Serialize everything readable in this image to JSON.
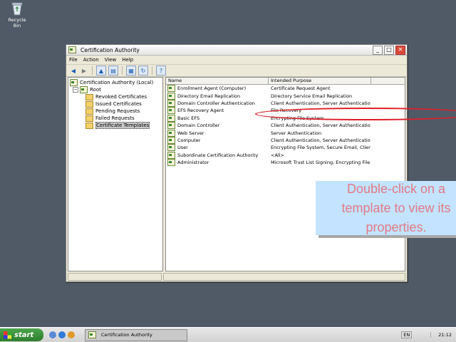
{
  "desktop": {
    "recycle_bin_label": "Recycle Bin"
  },
  "window": {
    "title": "Certification Authority",
    "buttons": {
      "minimize": "_",
      "maximize": "□",
      "close": "✕"
    }
  },
  "menu": [
    "File",
    "Action",
    "View",
    "Help"
  ],
  "tree": {
    "root_label": "Certification Authority (Local)",
    "ca_label": "Root",
    "folders": [
      "Revoked Certificates",
      "Issued Certificates",
      "Pending Requests",
      "Failed Requests",
      "Certificate Templates"
    ],
    "selected_index": 4
  },
  "list": {
    "headers": [
      "Name",
      "Intended Purpose"
    ],
    "rows": [
      {
        "name": "Enrollment Agent (Computer)",
        "purpose": "Certificate Request Agent"
      },
      {
        "name": "Directory Email Replication",
        "purpose": "Directory Service Email Replication"
      },
      {
        "name": "Domain Controller Authentication",
        "purpose": "Client Authentication, Server Authenticatio..."
      },
      {
        "name": "EFS Recovery Agent",
        "purpose": "File Recovery"
      },
      {
        "name": "Basic EFS",
        "purpose": "Encrypting File System"
      },
      {
        "name": "Domain Controller",
        "purpose": "Client Authentication, Server Authentication"
      },
      {
        "name": "Web Server",
        "purpose": "Server Authentication"
      },
      {
        "name": "Computer",
        "purpose": "Client Authentication, Server Authentication"
      },
      {
        "name": "User",
        "purpose": "Encrypting File System, Secure Email, Clien..."
      },
      {
        "name": "Subordinate Certification Authority",
        "purpose": "<All>"
      },
      {
        "name": "Administrator",
        "purpose": "Microsoft Trust List Signing, Encrypting File..."
      }
    ]
  },
  "callout": {
    "text": "Double-click on a\ntemplate to view its\nproperties."
  },
  "colors": {
    "highlight_ellipse": "#e0202a",
    "callout_bg": "#c3e3ff",
    "callout_text": "#e27a84"
  },
  "taskbar": {
    "start_label": "start",
    "task_label": "Certification Authority",
    "language": "EN",
    "clock": "21:12"
  }
}
